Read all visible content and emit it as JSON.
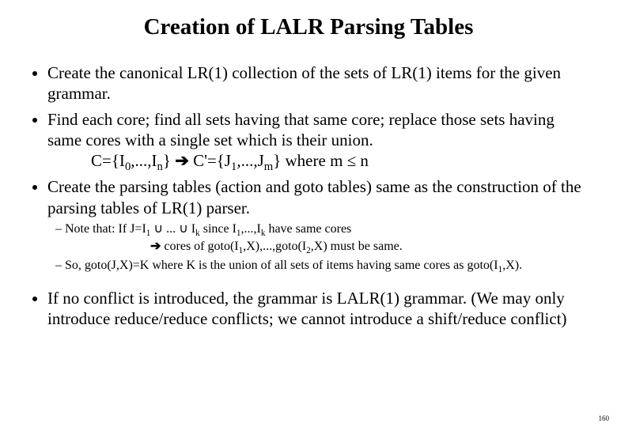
{
  "title": "Creation of LALR Parsing Tables",
  "bullets": {
    "b1": "Create the canonical LR(1) collection of the sets of LR(1) items for the given grammar.",
    "b2": "Find each core; find all sets having that same core; replace those sets having same cores with a single set which is their union.",
    "b2_line_pre": "C={I",
    "b2_line_mid1": ",...,I",
    "b2_line_close1": "}  ",
    "b2_arrow": "➔",
    "b2_line_post": "  C'={J",
    "b2_line_mid2": ",...,J",
    "b2_line_close2": "}            where m ≤ n",
    "sub0": "0",
    "subn": "n",
    "sub1": "1",
    "subm": "m",
    "b3": "Create the parsing tables (action and goto tables) same as the construction of the parsing tables of LR(1) parser.",
    "note1_pre": "Note that:   If  J=I",
    "note1_mid": " ∪ ... ∪ I",
    "note1_post": "  since I",
    "note1_end": " have same cores",
    "note1_comma": ",...,I",
    "subk": "k",
    "note1b_arrow": "➔",
    "note1b": " cores of goto(I",
    "note1b_mid": ",X),...,goto(I",
    "note1b_end": ",X) must be same.",
    "sub2": "2",
    "note2_pre": "So, goto(J,X)=K  where K is the union of all sets of items having same cores as goto(I",
    "note2_end": ",X).",
    "b4": "If no conflict is introduced, the grammar is LALR(1) grammar. (We may only introduce reduce/reduce conflicts; we cannot introduce a shift/reduce conflict)"
  },
  "page": "160"
}
